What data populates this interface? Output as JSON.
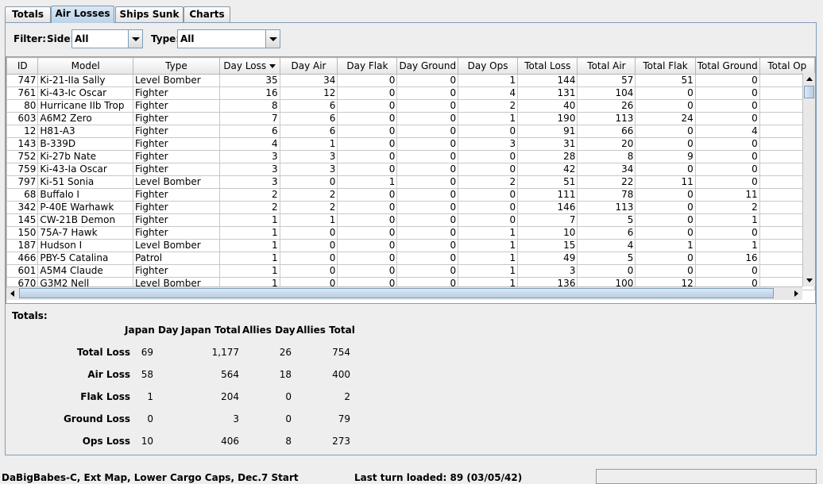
{
  "tabs": [
    {
      "label": "Totals",
      "active": false
    },
    {
      "label": "Air Losses",
      "active": true
    },
    {
      "label": "Ships Sunk",
      "active": false
    },
    {
      "label": "Charts",
      "active": false
    }
  ],
  "filter": {
    "label": "Filter:",
    "side_label": "Side:",
    "side_value": "All",
    "type_label": "Type:",
    "type_value": "All"
  },
  "table": {
    "columns": [
      "ID",
      "Model",
      "Type",
      "Day Loss",
      "Day Air",
      "Day Flak",
      "Day Ground",
      "Day Ops",
      "Total Loss",
      "Total Air",
      "Total Flak",
      "Total Ground",
      "Total Op"
    ],
    "sorted_column": "Day Loss",
    "rows": [
      [
        "747",
        "Ki-21-IIa Sally",
        "Level Bomber",
        "35",
        "34",
        "0",
        "0",
        "1",
        "144",
        "57",
        "51",
        "0"
      ],
      [
        "761",
        "Ki-43-Ic Oscar",
        "Fighter",
        "16",
        "12",
        "0",
        "0",
        "4",
        "131",
        "104",
        "0",
        "0"
      ],
      [
        "80",
        "Hurricane IIb Trop",
        "Fighter",
        "8",
        "6",
        "0",
        "0",
        "2",
        "40",
        "26",
        "0",
        "0"
      ],
      [
        "603",
        "A6M2 Zero",
        "Fighter",
        "7",
        "6",
        "0",
        "0",
        "1",
        "190",
        "113",
        "24",
        "0"
      ],
      [
        "12",
        "H81-A3",
        "Fighter",
        "6",
        "6",
        "0",
        "0",
        "0",
        "91",
        "66",
        "0",
        "4"
      ],
      [
        "143",
        "B-339D",
        "Fighter",
        "4",
        "1",
        "0",
        "0",
        "3",
        "31",
        "20",
        "0",
        "0"
      ],
      [
        "752",
        "Ki-27b Nate",
        "Fighter",
        "3",
        "3",
        "0",
        "0",
        "0",
        "28",
        "8",
        "9",
        "0"
      ],
      [
        "759",
        "Ki-43-Ia Oscar",
        "Fighter",
        "3",
        "3",
        "0",
        "0",
        "0",
        "42",
        "34",
        "0",
        "0"
      ],
      [
        "797",
        "Ki-51 Sonia",
        "Level Bomber",
        "3",
        "0",
        "1",
        "0",
        "2",
        "51",
        "22",
        "11",
        "0"
      ],
      [
        "68",
        "Buffalo I",
        "Fighter",
        "2",
        "2",
        "0",
        "0",
        "0",
        "111",
        "78",
        "0",
        "11"
      ],
      [
        "342",
        "P-40E Warhawk",
        "Fighter",
        "2",
        "2",
        "0",
        "0",
        "0",
        "146",
        "113",
        "0",
        "2"
      ],
      [
        "145",
        "CW-21B Demon",
        "Fighter",
        "1",
        "1",
        "0",
        "0",
        "0",
        "7",
        "5",
        "0",
        "1"
      ],
      [
        "150",
        "75A-7 Hawk",
        "Fighter",
        "1",
        "0",
        "0",
        "0",
        "1",
        "10",
        "6",
        "0",
        "0"
      ],
      [
        "187",
        "Hudson I",
        "Level Bomber",
        "1",
        "0",
        "0",
        "0",
        "1",
        "15",
        "4",
        "1",
        "1"
      ],
      [
        "466",
        "PBY-5 Catalina",
        "Patrol",
        "1",
        "0",
        "0",
        "0",
        "1",
        "49",
        "5",
        "0",
        "16"
      ],
      [
        "601",
        "A5M4 Claude",
        "Fighter",
        "1",
        "0",
        "0",
        "0",
        "1",
        "3",
        "0",
        "0",
        "0"
      ],
      [
        "670",
        "G3M2 Nell",
        "Level Bomber",
        "1",
        "0",
        "0",
        "0",
        "1",
        "136",
        "100",
        "12",
        "0"
      ]
    ]
  },
  "totals": {
    "title": "Totals:",
    "headers": [
      "Japan Day",
      "Japan Total",
      "Allies Day",
      "Allies Total"
    ],
    "rows": [
      {
        "label": "Total Loss",
        "values": [
          "69",
          "1,177",
          "26",
          "754"
        ]
      },
      {
        "label": "Air Loss",
        "values": [
          "58",
          "564",
          "18",
          "400"
        ]
      },
      {
        "label": "Flak Loss",
        "values": [
          "1",
          "204",
          "0",
          "2"
        ]
      },
      {
        "label": "Ground Loss",
        "values": [
          "0",
          "3",
          "0",
          "79"
        ]
      },
      {
        "label": "Ops Loss",
        "values": [
          "10",
          "406",
          "8",
          "273"
        ]
      }
    ]
  },
  "status": {
    "scenario": "DaBigBabes-C, Ext Map, Lower Cargo Caps, Dec.7 Start",
    "last_turn": "Last turn loaded: 89 (03/05/42)"
  }
}
